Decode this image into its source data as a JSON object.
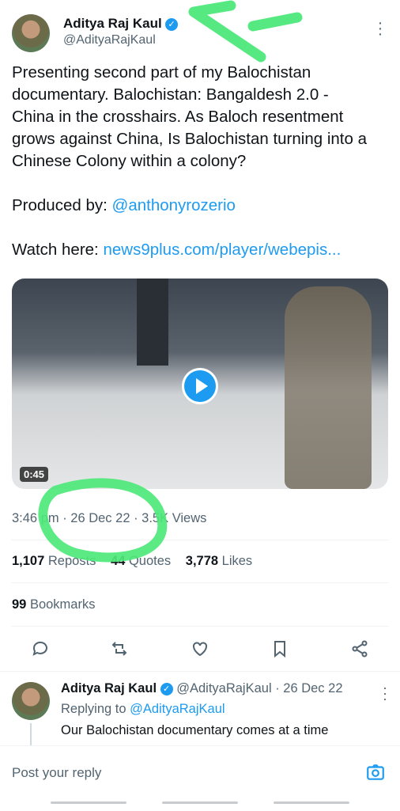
{
  "tweet": {
    "author_name": "Aditya Raj Kaul",
    "author_handle": "@AdityaRajKaul",
    "text_lines": [
      "Presenting second part of my Balochistan",
      "documentary. Balochistan: Bangaldesh 2.0 -",
      "China in the crosshairs. As Baloch resentment",
      "grows against China, Is Balochistan turning into a",
      "Chinese Colony within a colony?"
    ],
    "produced_by_label": "Produced by:",
    "produced_by_handle": "@anthonyrozerio",
    "watch_label": "Watch here:",
    "watch_link": "news9plus.com/player/webepis...",
    "video_duration": "0:45",
    "timestamp": "3:46 pm · 26 Dec 22 · 3.5K Views",
    "reposts_count": "1,107",
    "reposts_label": "Reposts",
    "quotes_count": "44",
    "quotes_label": "Quotes",
    "likes_count": "3,778",
    "likes_label": "Likes",
    "bookmarks_count": "99",
    "bookmarks_label": "Bookmarks"
  },
  "reply": {
    "author_name": "Aditya Raj Kaul",
    "author_handle": "@AdityaRajKaul",
    "date": "· 26 Dec 22",
    "replying_to_label": "Replying to",
    "replying_to_handle": "@AdityaRajKaul",
    "text_line1": "Our Balochistan documentary comes at a time"
  },
  "composer": {
    "placeholder": "Post your reply"
  },
  "icons": [
    "more-icon",
    "verified-icon",
    "play-icon",
    "reply-icon",
    "repost-icon",
    "like-icon",
    "bookmark-icon",
    "share-icon",
    "camera-icon"
  ],
  "colors": {
    "link": "#1d9bf0",
    "muted": "#536471",
    "annotation": "#4ee87a"
  }
}
